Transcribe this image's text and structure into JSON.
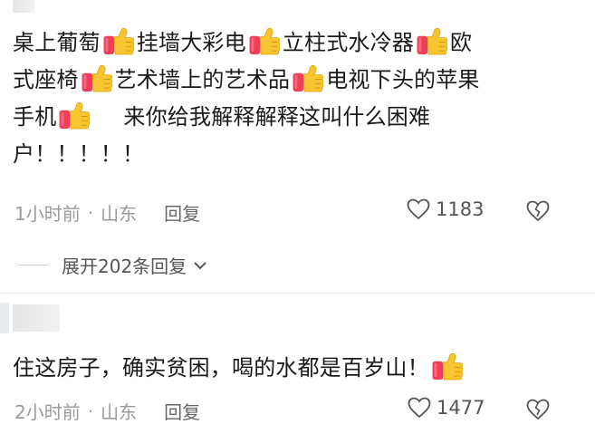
{
  "comment1": {
    "segments": [
      "桌上葡萄",
      "挂墙大彩电",
      "立柱式水冷器",
      "欧",
      "式座椅",
      "艺术墙上的艺术品",
      "电视下头的苹果",
      "手机",
      "来你给我解释解释这叫什么困难",
      "户！！！！！"
    ],
    "time": "1小时前",
    "location": "山东",
    "reply_label": "回复",
    "likes": "1183",
    "expand_label": "展开202条回复"
  },
  "comment2": {
    "text": "住这房子，确实贫困，喝的水都是百岁山！",
    "time": "2小时前",
    "location": "山东",
    "reply_label": "回复",
    "likes": "1477"
  },
  "icons": {
    "thumbs_up": "thumbs-up-emoji",
    "heart": "heart-outline-icon",
    "dislike": "broken-heart-icon",
    "chevron": "chevron-down-icon"
  },
  "colors": {
    "thumb_hand": "#f7c531",
    "thumb_cuff": "#ef3d5a",
    "meta_text": "#9a9a9a"
  }
}
